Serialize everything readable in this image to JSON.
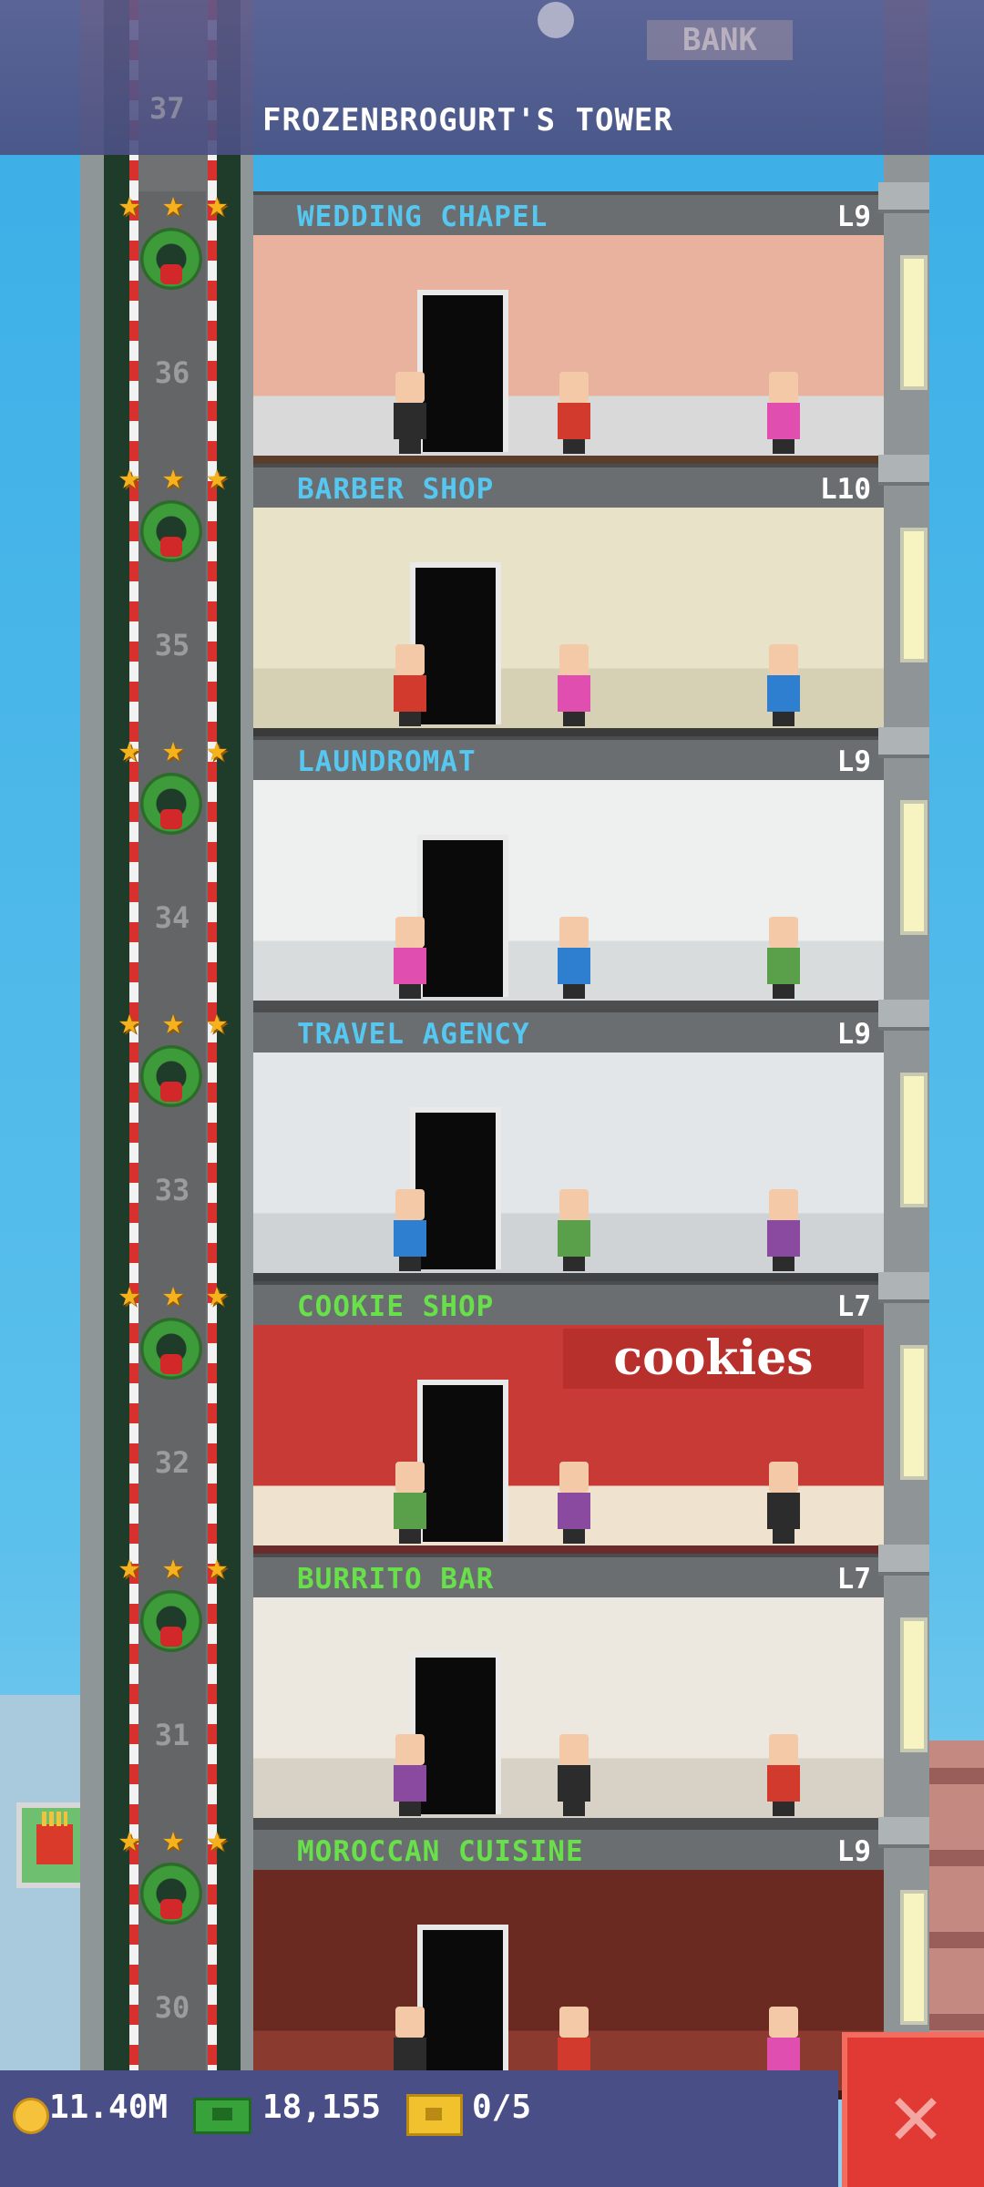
{
  "header": {
    "tower_title": "FROZENBROGURT'S TOWER",
    "background_sign": "BANK",
    "background_floor_number": "37"
  },
  "floors": [
    {
      "name": "WEDDING CHAPEL",
      "level": "L9",
      "number": "36",
      "label_color": "blue"
    },
    {
      "name": "BARBER SHOP",
      "level": "L10",
      "number": "35",
      "label_color": "blue"
    },
    {
      "name": "LAUNDROMAT",
      "level": "L9",
      "number": "34",
      "label_color": "blue"
    },
    {
      "name": "TRAVEL AGENCY",
      "level": "L9",
      "number": "33",
      "label_color": "blue"
    },
    {
      "name": "COOKIE SHOP",
      "level": "L7",
      "number": "32",
      "label_color": "green",
      "sign": "cookies"
    },
    {
      "name": "BURRITO BAR",
      "level": "L7",
      "number": "31",
      "label_color": "green"
    },
    {
      "name": "MOROCCAN CUISINE",
      "level": "L9",
      "number": "30",
      "label_color": "green"
    }
  ],
  "stats": {
    "coins": "11.40M",
    "bux": "18,155",
    "tickets": "0/5"
  },
  "icons": {
    "coin": "coin-icon",
    "bux": "cash-icon",
    "tickets": "ticket-icon",
    "close": "close-icon",
    "star": "star-icon",
    "wreath": "wreath-icon"
  },
  "colors": {
    "sky": "#3fb3e6",
    "label_blue": "#55c7f0",
    "label_green": "#68e04a",
    "close_button": "#e13a34",
    "bottom_bar": "#4a4e86"
  }
}
